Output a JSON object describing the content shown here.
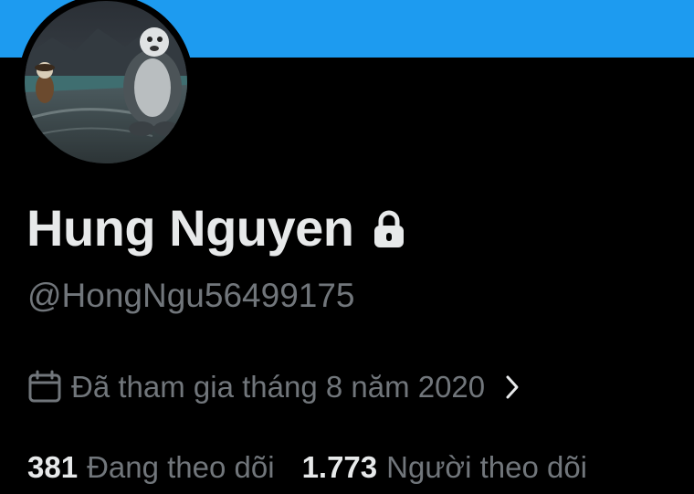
{
  "colors": {
    "banner": "#1d9bf0",
    "background": "#000000",
    "primary_text": "#e7e9ea",
    "secondary_text": "#71767b"
  },
  "profile": {
    "display_name": "Hung Nguyen",
    "handle": "@HongNgu56499175",
    "protected_icon": "lock-icon",
    "avatar_icon": "avatar-photo"
  },
  "joined": {
    "icon": "calendar-icon",
    "text": "Đã tham gia tháng 8 năm 2020",
    "chevron_icon": "chevron-right-icon"
  },
  "stats": {
    "following_count": "381",
    "following_label": "Đang theo dõi",
    "followers_count": "1.773",
    "followers_label": "Người theo dõi"
  }
}
